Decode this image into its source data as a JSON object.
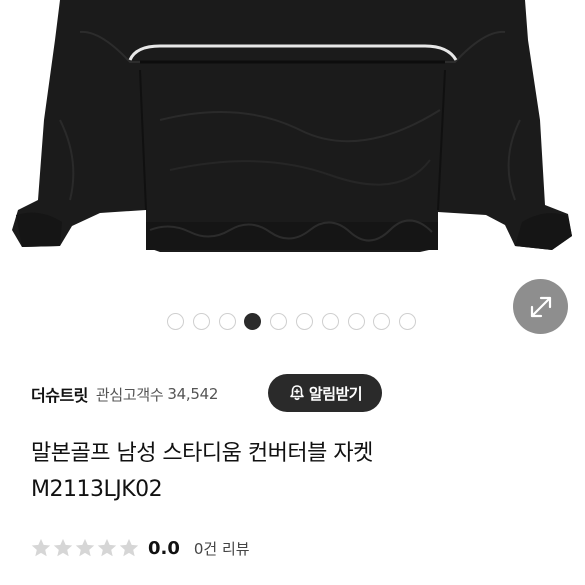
{
  "product_image": {
    "alt": "black nylon jacket",
    "slide_count": 10,
    "active_slide_index": 3
  },
  "expand_icon": "expand-diagonal-icon",
  "brand": {
    "name": "더슈트릿",
    "follower_label": "관심고객수",
    "follower_count": "34,542"
  },
  "alert_button": {
    "label": "알림받기",
    "icon": "bell-plus-icon"
  },
  "title": {
    "line1": "말본골프 남성 스타디움 컨버터블 자켓",
    "line2": "M2113LJK02"
  },
  "rating": {
    "stars_filled": 0,
    "stars_total": 5,
    "score": "0.0",
    "review_text": "0건 리뷰"
  },
  "colors": {
    "jacket": "#1a1a1a",
    "dark_button": "#2a2a2a",
    "expand_button": "#8e8e8e",
    "dot_active": "#2b2b2b",
    "dot_inactive_border": "#cfcfcf",
    "star_empty": "#d6d6d6"
  }
}
